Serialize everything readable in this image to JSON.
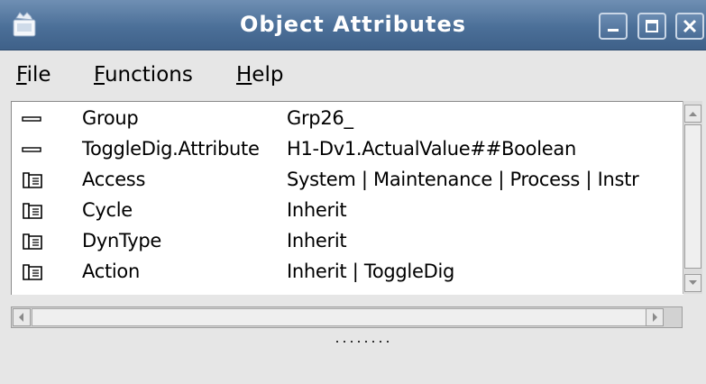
{
  "window": {
    "title": "Object Attributes",
    "titlebar_color": "#4b6f98"
  },
  "menu": {
    "file": {
      "mnemonic": "F",
      "rest": "ile"
    },
    "functions": {
      "mnemonic": "F",
      "rest": "unctions"
    },
    "help": {
      "mnemonic": "H",
      "rest": "elp"
    }
  },
  "attributes": [
    {
      "icon": "dash-icon",
      "name": "Group",
      "value": "Grp26_"
    },
    {
      "icon": "dash-icon",
      "name": "ToggleDig.Attribute",
      "value": " H1-Dv1.ActualValue##Boolean"
    },
    {
      "icon": "folder-icon",
      "name": "Access",
      "value": "System | Maintenance | Process | Instr"
    },
    {
      "icon": "folder-icon",
      "name": "Cycle",
      "value": "Inherit"
    },
    {
      "icon": "folder-icon",
      "name": "DynType",
      "value": "Inherit"
    },
    {
      "icon": "folder-icon",
      "name": "Action",
      "value": "Inherit | ToggleDig"
    }
  ]
}
